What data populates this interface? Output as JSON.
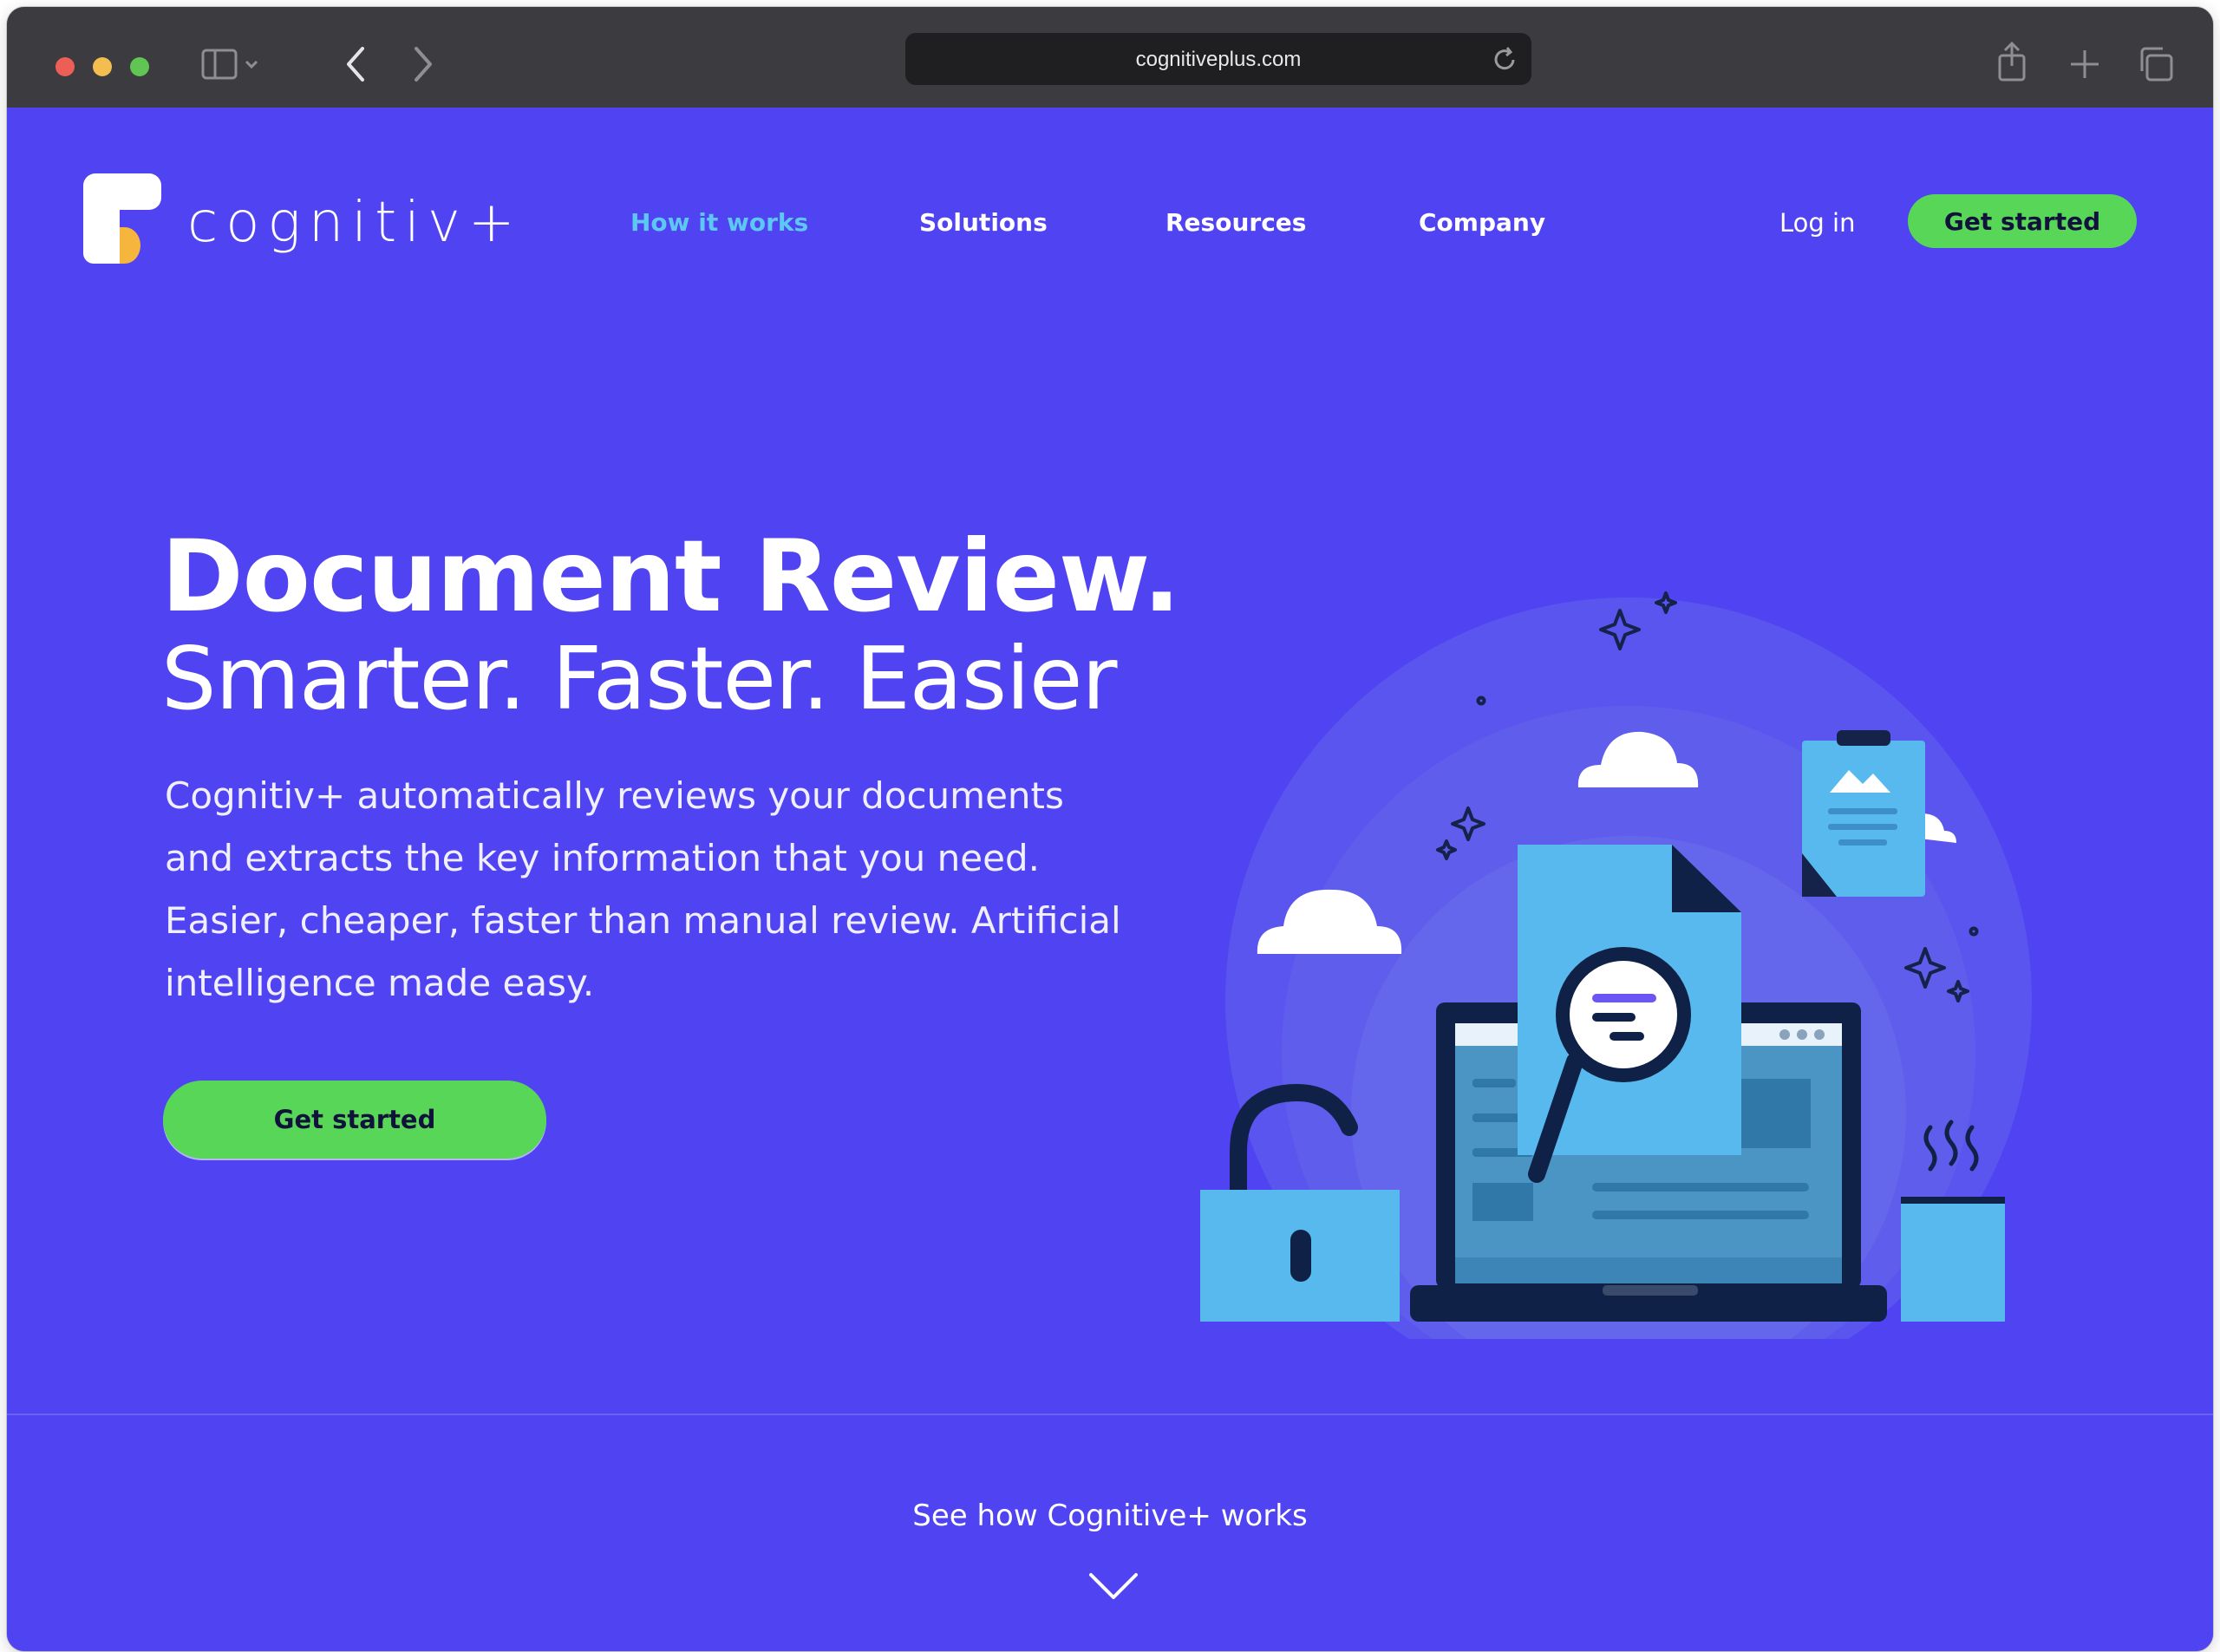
{
  "browser": {
    "url": "cognitiveplus.com"
  },
  "header": {
    "logo_text": "cognitiv+",
    "nav": [
      {
        "label": "How it works",
        "active": true
      },
      {
        "label": "Solutions",
        "active": false
      },
      {
        "label": "Resources",
        "active": false
      },
      {
        "label": "Company",
        "active": false
      }
    ],
    "login_label": "Log in",
    "cta_label": "Get started"
  },
  "hero": {
    "title": "Document Review.",
    "subtitle": "Smarter. Faster. Easier",
    "description": "Cognitiv+ automatically reviews your documents and extracts the key information that you need. Easier, cheaper, faster than manual review. Artificial intelligence made easy.",
    "cta_label": "Get started"
  },
  "footer_prompt": {
    "label": "See how Cognitive+ works"
  },
  "colors": {
    "background": "#5043f2",
    "accent_green": "#58d657",
    "active_link": "#5ec8f5",
    "illustration_blue": "#58b9ee",
    "illustration_dark": "#0f2147"
  }
}
